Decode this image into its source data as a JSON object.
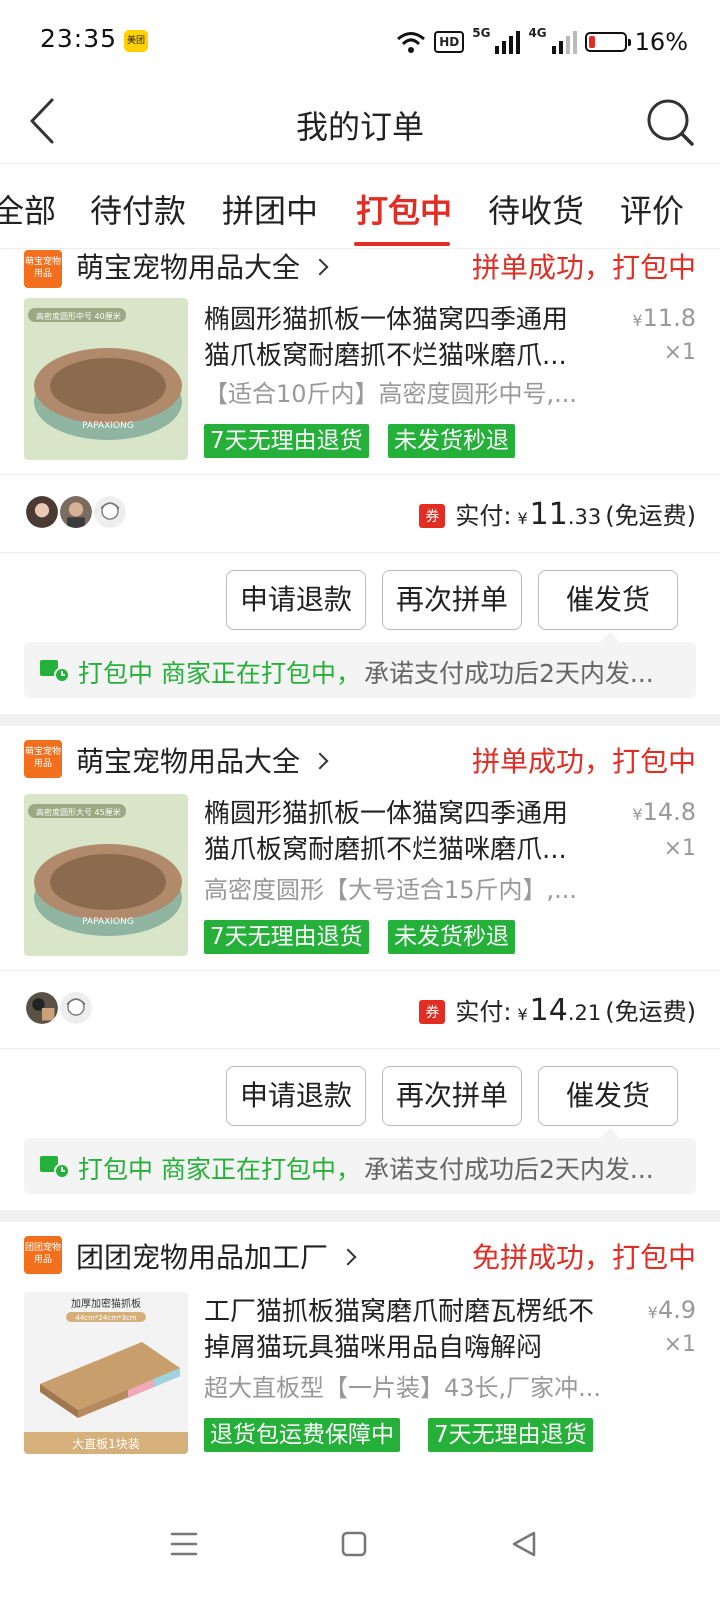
{
  "status_bar": {
    "time": "23:35",
    "app_badge": "美团",
    "hd_label": "HD",
    "sig1_label": "5G",
    "sig2_label": "4G",
    "battery_level": 0.16,
    "battery_text": "16%"
  },
  "header": {
    "title": "我的订单",
    "back_icon": "chevron-left-icon",
    "search_icon": "search-icon"
  },
  "tabs": [
    {
      "label": "全部",
      "active": false
    },
    {
      "label": "待付款",
      "active": false
    },
    {
      "label": "拼团中",
      "active": false
    },
    {
      "label": "打包中",
      "active": true
    },
    {
      "label": "待收货",
      "active": false
    },
    {
      "label": "评价",
      "active": false
    }
  ],
  "colors": {
    "accent": "#e02e24",
    "green": "#25b03a",
    "shop_logo": "#f26f1d"
  },
  "orders": [
    {
      "shop_logo_text": "萌宝宠物用品",
      "shop_name": "萌宝宠物用品大全",
      "status": "拼单成功，打包中",
      "image_caption": "高密度圆形中号 40厘米",
      "image_brand": "PAPAXIONG",
      "title_line1": "椭圆形猫抓板一体猫窝四季通用",
      "title_line2": "猫爪板窝耐磨抓不烂猫咪磨爪...",
      "price_yen": "¥",
      "price_value": "11.8",
      "quantity": "×1",
      "sku": "【适合10斤内】高密度圆形中号,...",
      "tags": [
        "7天无理由退货",
        "未发货秒退"
      ],
      "paid_label": "实付:",
      "coupon": "券",
      "paid_yen": "¥",
      "paid_int": "11",
      "paid_dec": ".33",
      "shipping": "(免运费)",
      "buttons": [
        "申请退款",
        "再次拼单",
        "催发货"
      ],
      "notice_green": "打包中 商家正在打包中，",
      "notice_gray": "承诺支付成功后2天内发..."
    },
    {
      "shop_logo_text": "萌宝宠物用品",
      "shop_name": "萌宝宠物用品大全",
      "status": "拼单成功，打包中",
      "image_caption": "高密度圆形大号 45厘米",
      "image_brand": "PAPAXIONG",
      "title_line1": "椭圆形猫抓板一体猫窝四季通用",
      "title_line2": "猫爪板窝耐磨抓不烂猫咪磨爪...",
      "price_yen": "¥",
      "price_value": "14.8",
      "quantity": "×1",
      "sku": "高密度圆形【大号适合15斤内】,...",
      "tags": [
        "7天无理由退货",
        "未发货秒退"
      ],
      "paid_label": "实付:",
      "coupon": "券",
      "paid_yen": "¥",
      "paid_int": "14",
      "paid_dec": ".21",
      "shipping": "(免运费)",
      "buttons": [
        "申请退款",
        "再次拼单",
        "催发货"
      ],
      "notice_green": "打包中 商家正在打包中，",
      "notice_gray": "承诺支付成功后2天内发..."
    },
    {
      "shop_logo_text": "团团宠物用品",
      "shop_name": "团团宠物用品加工厂",
      "status": "免拼成功，打包中",
      "image_caption": "加厚加密猫抓板",
      "image_size": "44cm*24cm*3cm",
      "image_label": "大直板1块装",
      "title_line1": "工厂猫抓板猫窝磨爪耐磨瓦楞纸不",
      "title_line2": "掉屑猫玩具猫咪用品自嗨解闷",
      "price_yen": "¥",
      "price_value": "4.9",
      "quantity": "×1",
      "sku": "超大直板型【一片装】43长,厂家冲...",
      "tags": [
        "退货包运费保障中",
        "7天无理由退货"
      ]
    }
  ],
  "nav": {
    "menu_icon": "menu-icon",
    "home_icon": "square-home-icon",
    "back_icon": "triangle-back-icon"
  }
}
